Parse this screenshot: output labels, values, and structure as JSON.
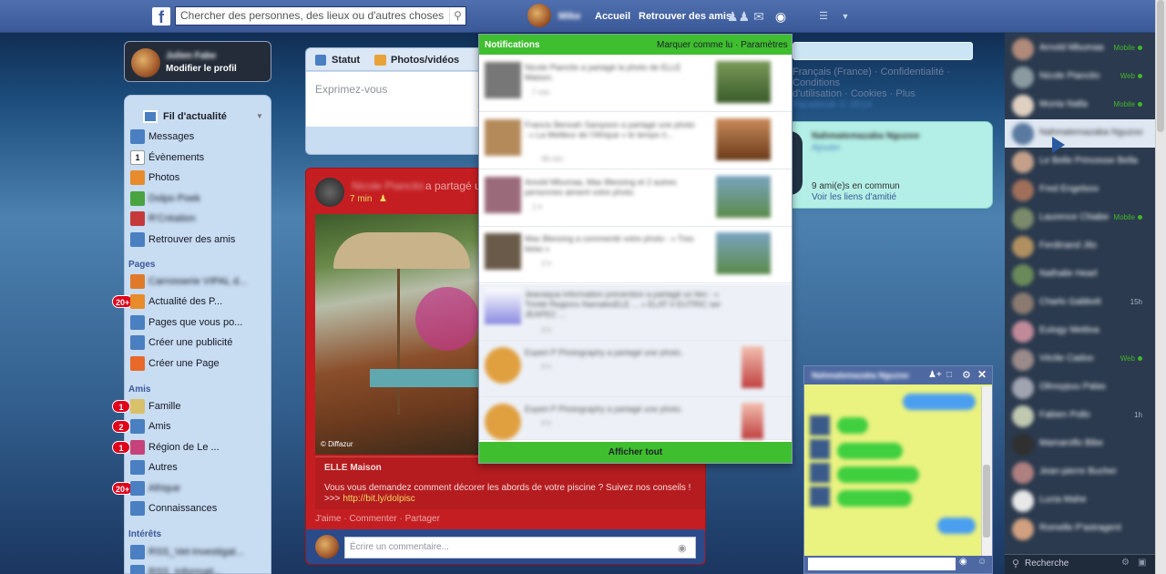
{
  "topbar": {
    "logo": "f",
    "search_placeholder": "Chercher des personnes, des lieux ou d'autres choses",
    "user_name": "Mike",
    "home": "Accueil",
    "find_friends": "Retrouver des amis"
  },
  "profile": {
    "name": "Julien Fabe",
    "edit": "Modifier le profil"
  },
  "nav": {
    "newsfeed": "Fil d'actualité",
    "items": [
      {
        "label": "Messages",
        "color": "#4a7fc1"
      },
      {
        "label": "Évènements",
        "color": "#ffffff"
      },
      {
        "label": "Photos",
        "color": "#e88b2a"
      },
      {
        "label": "Dolpo Poek",
        "color": "#48a340"
      },
      {
        "label": "R'Création",
        "color": "#c43a3a"
      },
      {
        "label": "Retrouver des amis",
        "color": "#4a7fc1"
      }
    ],
    "events_icon_text": "1",
    "pages_heading": "Pages",
    "pages": [
      {
        "label": "Carrosserie VIPAL d...",
        "badge": ""
      },
      {
        "label": "Actualité des P...",
        "badge": "20+"
      },
      {
        "label": "Pages que vous po...",
        "badge": ""
      },
      {
        "label": "Créer une publicité",
        "badge": ""
      },
      {
        "label": "Créer une Page",
        "badge": ""
      }
    ],
    "friends_heading": "Amis",
    "friends": [
      {
        "label": "Famille",
        "badge": "1"
      },
      {
        "label": "Amis",
        "badge": "2"
      },
      {
        "label": "Région de Le ...",
        "badge": "1"
      },
      {
        "label": "Autres",
        "badge": ""
      },
      {
        "label": "Afrique",
        "badge": "20+"
      },
      {
        "label": "Connaissances",
        "badge": ""
      }
    ],
    "interests_heading": "Intérêts",
    "interests": [
      {
        "label": "RSS_Vet-Investigat..."
      },
      {
        "label": "RSS_Informati..."
      }
    ]
  },
  "composer": {
    "tab_status": "Statut",
    "tab_photos": "Photos/vidéos",
    "placeholder": "Exprimez-vous"
  },
  "post": {
    "author": "Nicole Piancito",
    "action": "a partagé u",
    "time": "7 min",
    "photo_credit": "© Diffazur",
    "source": "ELLE Maison",
    "text": "Vous vous demandez comment décorer les abords de votre piscine ? Suivez nos conseils !",
    "link_prefix": ">>>",
    "link": "http://bit.ly/dolpisc",
    "actions": "J'aime · Commenter · Partager",
    "comment_placeholder": "Écrire un commentaire..."
  },
  "notifications": {
    "title": "Notifications",
    "mark_read": "Marquer comme lu",
    "settings": "Paramètres",
    "see_all": "Afficher tout",
    "items": [
      {
        "text": "Nicole Piancito a partagé la photo de ELLE Maison.",
        "time": "7 min"
      },
      {
        "text": "Francis Benoah Sampson a partagé une photo : « La Meilleur de l'Afrique » le temps ri...",
        "time": "48 min"
      },
      {
        "text": "Amold Mbumaa, Max Blessing et 2 autres personnes aiment votre photo.",
        "time": "1 h"
      },
      {
        "text": "Max Blessing a commenté votre photo : « Tres beau »",
        "time": "2 h"
      },
      {
        "text": "Jeanaqua information prevention a partagé un lien : « Trinité Regions NamalesELE ... » ELAT II EUTRIC ser JEAPEC ...",
        "time": "3 h"
      },
      {
        "text": "Expert P Photography a partagé une photo.",
        "time": "4 h"
      },
      {
        "text": "Expert P Photography a partagé une photo.",
        "time": "4 h"
      }
    ]
  },
  "footer_links": {
    "line1": "Français (France) · Confidentialité · Conditions",
    "line2": "d'utilisation · Cookies · Plus",
    "line3": "Facebook © 2014"
  },
  "suggestion": {
    "name": "Nahmatemazaba Nguzoo",
    "add": "Ajouter",
    "mutual": "9 ami(e)s en commun",
    "see_links": "Voir les liens d'amitié"
  },
  "chat": {
    "contacts": [
      {
        "name": "Arnold Mbumaa",
        "status": "Mobile"
      },
      {
        "name": "Nicole Piancito",
        "status": "Web"
      },
      {
        "name": "Munia Nalla",
        "status": "Mobile"
      },
      {
        "name": "Nahmatemazaba Nguzoo",
        "status": ""
      },
      {
        "name": "Le Belle Princesse Bella",
        "status": ""
      },
      {
        "name": "Fred Engelsoo",
        "status": ""
      },
      {
        "name": "Laurence Chiabe",
        "status": "Mobile"
      },
      {
        "name": "Ferdinand Jilo",
        "status": ""
      },
      {
        "name": "Nathalie Hearl",
        "status": ""
      },
      {
        "name": "Charlo Gabbott",
        "status": "15h"
      },
      {
        "name": "Eulogy Mettiva",
        "status": ""
      },
      {
        "name": "Véclie Cadoo",
        "status": "Web"
      },
      {
        "name": "Olinoypuu Palas",
        "status": ""
      },
      {
        "name": "Fabien Pollo",
        "status": "1h"
      },
      {
        "name": "Mamaroflo Bibe",
        "status": ""
      },
      {
        "name": "Jean-pierre Bucher",
        "status": ""
      },
      {
        "name": "Lucia Mahe",
        "status": ""
      },
      {
        "name": "Romelle P'astragent",
        "status": ""
      }
    ],
    "search_placeholder": "Recherche"
  },
  "chatwindow": {
    "name": "Nahmatemazaba Nguzoo"
  }
}
